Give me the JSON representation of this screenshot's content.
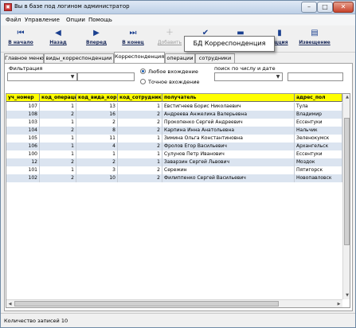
{
  "window": {
    "title": "Вы в базе под логином администратор"
  },
  "menu": [
    "Файл",
    "Управление",
    "Опции",
    "Помощь"
  ],
  "toolbar": [
    {
      "label": "В начало",
      "icon": "first-record-icon",
      "glyph": "⏮",
      "enabled": true
    },
    {
      "label": "Назад",
      "icon": "previous-record-icon",
      "glyph": "◀",
      "enabled": true
    },
    {
      "label": "Вперед",
      "icon": "next-record-icon",
      "glyph": "▶",
      "enabled": true
    },
    {
      "label": "В конец",
      "icon": "last-record-icon",
      "glyph": "⏭",
      "enabled": true
    },
    {
      "label": "Добавить",
      "icon": "add-record-icon",
      "glyph": "＋",
      "enabled": false
    },
    {
      "label": "",
      "icon": "checkmark-icon",
      "glyph": "✔",
      "enabled": true
    },
    {
      "label": "",
      "icon": "minus-icon",
      "glyph": "▬",
      "enabled": true
    },
    {
      "label": "ицция",
      "icon": "document-icon",
      "glyph": "▮",
      "enabled": true
    },
    {
      "label": "Извещение",
      "icon": "notice-icon",
      "glyph": "▤",
      "enabled": true
    }
  ],
  "tooltip": "БД Корреспонденция",
  "tabs": [
    "Главное меню",
    "виды_корреспонденции",
    "Корреспонденция",
    "операции",
    "сотрудники"
  ],
  "active_tab": 2,
  "filter": {
    "label": "Фильтрация",
    "radio_any": "Любое вхождение",
    "radio_exact": "Точное вхождение",
    "search_label": "поиск по числу и дате"
  },
  "table": {
    "columns": [
      "уч_номер",
      "код_операции",
      "код_вида_кор",
      "код_сотрудника",
      "получатель",
      "адрес_пол"
    ],
    "rows": [
      [
        "107",
        "1",
        "13",
        "1",
        "Евстигнеев Борис Николаевич",
        "Тула"
      ],
      [
        "108",
        "2",
        "16",
        "2",
        "Андреева Анжелика Валерьевна",
        "Владимир"
      ],
      [
        "103",
        "1",
        "2",
        "2",
        "Прокопенко Сергей Андреевич",
        "Ессентуки"
      ],
      [
        "104",
        "2",
        "8",
        "2",
        "Карпина Инна Анатольевна",
        "Нальчик"
      ],
      [
        "105",
        "1",
        "11",
        "1",
        "Зимина Ольга Константиновна",
        "Зеленокумск"
      ],
      [
        "106",
        "1",
        "4",
        "2",
        "Фролов Егор Васильевич",
        "Архангельск"
      ],
      [
        "100",
        "1",
        "1",
        "1",
        "Сулунов Петр Иванович",
        "Ессентуки"
      ],
      [
        "12",
        "2",
        "2",
        "1",
        "Заварзин Сергей Львович",
        "Моздок"
      ],
      [
        "101",
        "1",
        "3",
        "2",
        "Сережин",
        "Пятигорск"
      ],
      [
        "102",
        "2",
        "10",
        "2",
        "Филиппенко Сергей Васильевич",
        "Новопавловск"
      ]
    ]
  },
  "status": "Количество записей 10"
}
